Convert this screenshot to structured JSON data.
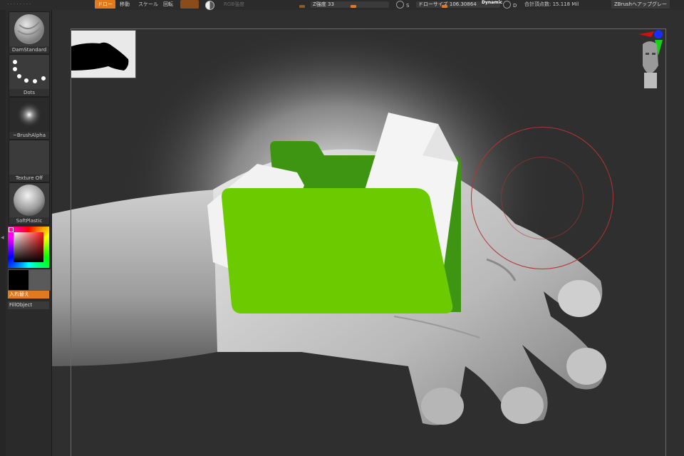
{
  "toolbar": {
    "draw_label": "ドロー",
    "move_label": "移動",
    "scale_label": "スケール",
    "rotate_label": "回転",
    "rgb_intensity_label": "RGB強度",
    "z_intensity_label": "Z強度",
    "z_intensity_value": "33",
    "s_label": "S",
    "draw_size_label": "ドローサイズ",
    "draw_size_value": "106.30864",
    "dynamic_label": "Dynamic",
    "d_label": "D",
    "total_points_label": "合計頂点数: 15.118 Mil",
    "help_label": "ZBrushヘアップグレー"
  },
  "left_panel": {
    "brush_label": "DamStandard",
    "stroke_label": "Dots",
    "alpha_label": "~BrushAlpha",
    "texture_label": "Texture Off",
    "material_label": "SoftPlastic",
    "swap_label": "入れ替え",
    "fill_label": "FillObject"
  },
  "colors": {
    "accent": "#e07a1f",
    "folder_front": "#6ccb00",
    "folder_back": "#3e9512",
    "brush_ring": "#b23434"
  },
  "icons": {
    "overlay": "folder-with-documents-icon",
    "navigator": "head-gizmo-icon"
  },
  "z_intensity_fraction": 0.33
}
